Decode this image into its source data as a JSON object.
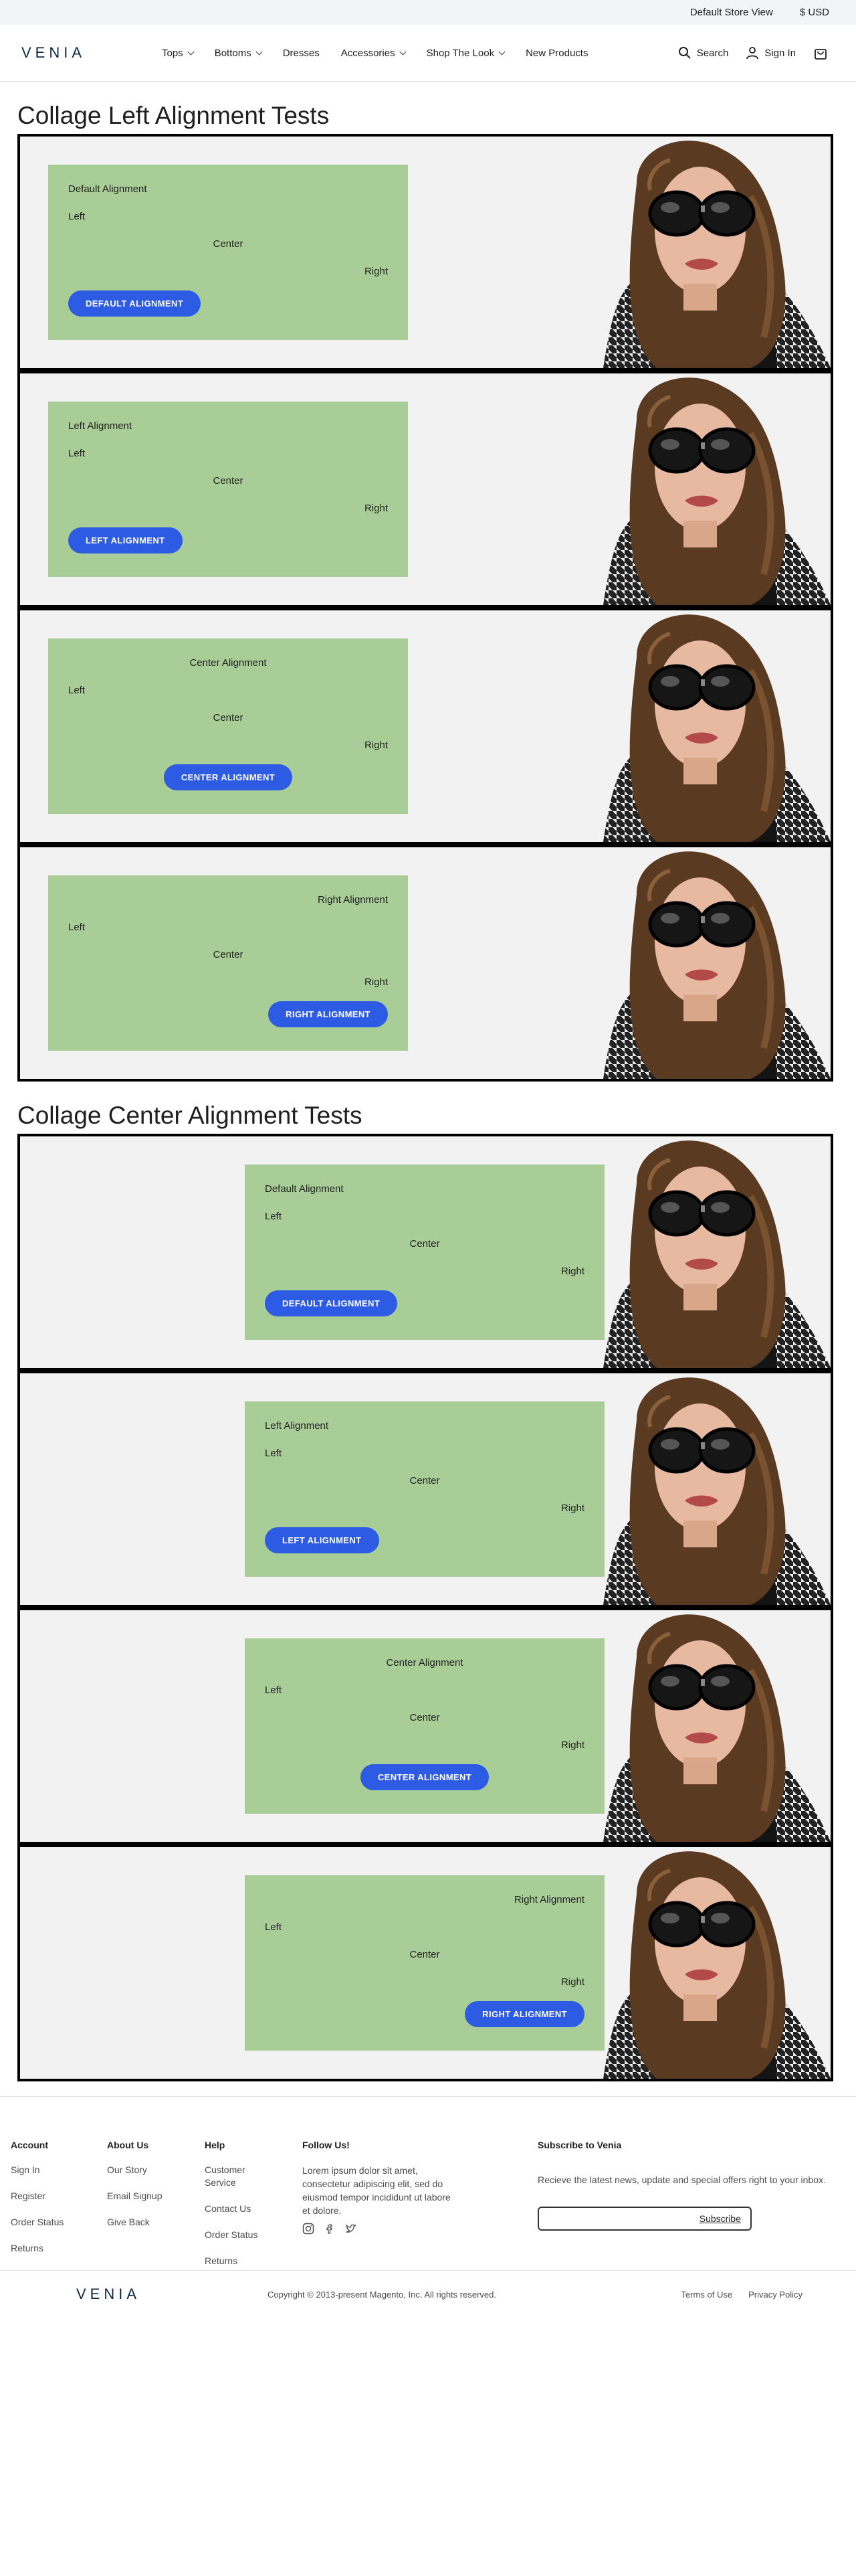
{
  "topbar": {
    "store": "Default Store View",
    "currency": "$ USD"
  },
  "header": {
    "logo": "VENIA",
    "nav": [
      "Tops",
      "Bottoms",
      "Dresses",
      "Accessories",
      "Shop The Look",
      "New Products"
    ],
    "search": "Search",
    "signin": "Sign In"
  },
  "sections": [
    {
      "title": "Collage Left Alignment Tests"
    },
    {
      "title": "Collage Center Alignment Tests"
    }
  ],
  "rows": [
    {
      "title": "Default Alignment",
      "left": "Left",
      "center": "Center",
      "right": "Right",
      "button": "DEFAULT ALIGNMENT"
    },
    {
      "title": "Left Alignment",
      "left": "Left",
      "center": "Center",
      "right": "Right",
      "button": "LEFT ALIGNMENT"
    },
    {
      "title": "Center Alignment",
      "left": "Left",
      "center": "Center",
      "right": "Right",
      "button": "CENTER ALIGNMENT"
    },
    {
      "title": "Right Alignment",
      "left": "Left",
      "center": "Center",
      "right": "Right",
      "button": "RIGHT ALIGNMENT"
    }
  ],
  "footer": {
    "account": {
      "title": "Account",
      "links": [
        "Sign In",
        "Register",
        "Order Status",
        "Returns"
      ]
    },
    "about": {
      "title": "About Us",
      "links": [
        "Our Story",
        "Email Signup",
        "Give Back"
      ]
    },
    "help": {
      "title": "Help",
      "links": [
        "Customer Service",
        "Contact Us",
        "Order Status",
        "Returns"
      ]
    },
    "follow": {
      "title": "Follow Us!",
      "text": "Lorem ipsum dolor sit amet, consectetur adipiscing elit, sed do eiusmod tempor incididunt ut labore et dolore."
    },
    "subscribe": {
      "title": "Subscribe to Venia",
      "text": "Recieve the latest news, update and special offers right to your inbox.",
      "button": "Subscribe"
    },
    "logo": "VENIA",
    "copyright": "Copyright © 2013-present Magento, Inc. All rights reserved.",
    "terms": "Terms of Use",
    "privacy": "Privacy Policy"
  }
}
